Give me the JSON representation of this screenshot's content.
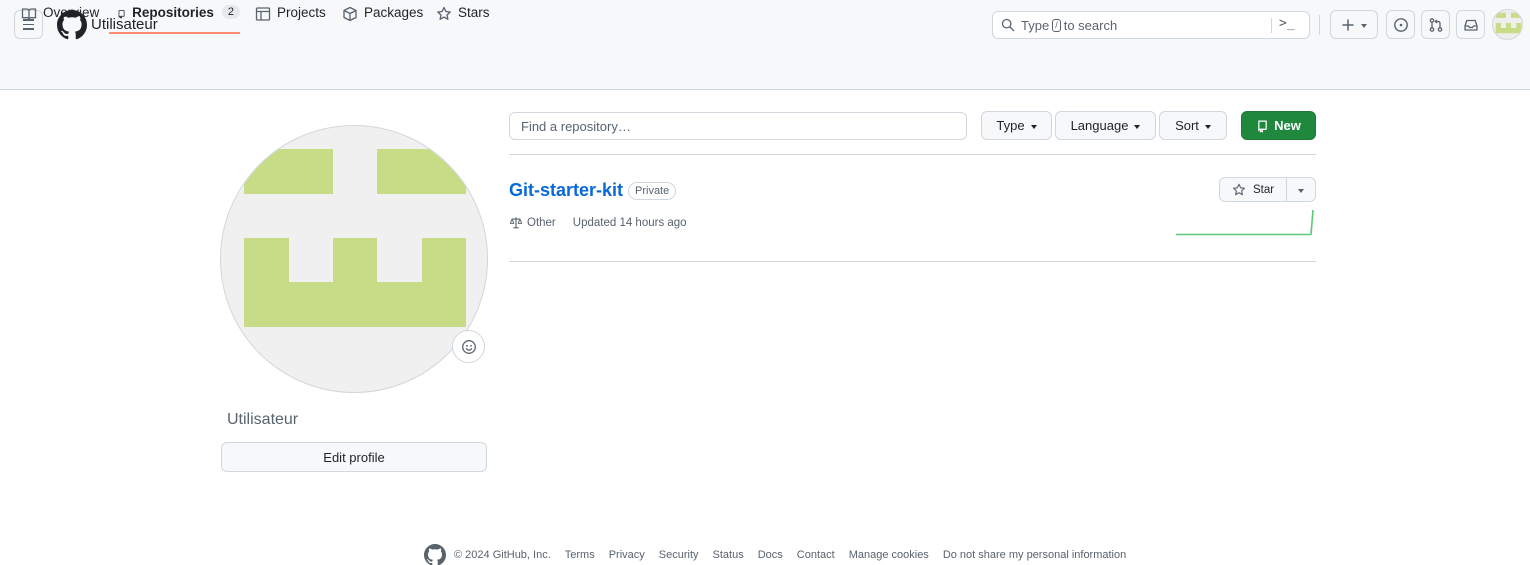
{
  "header": {
    "owner": "Utilisateur",
    "search": {
      "prefix": "Type",
      "key": "/",
      "suffix": "to search",
      "command_glyph": ">_"
    },
    "actions": [
      {
        "name": "create-new",
        "icon": "plus-icon"
      },
      {
        "name": "issues",
        "icon": "issue-opened-icon"
      },
      {
        "name": "pull-requests",
        "icon": "git-pull-request-icon"
      },
      {
        "name": "inbox",
        "icon": "inbox-icon"
      }
    ]
  },
  "tabs": [
    {
      "label": "Overview",
      "icon": "book-icon"
    },
    {
      "label": "Repositories",
      "icon": "repo-icon",
      "count": "2",
      "active": true
    },
    {
      "label": "Projects",
      "icon": "table-icon"
    },
    {
      "label": "Packages",
      "icon": "package-icon"
    },
    {
      "label": "Stars",
      "icon": "star-icon"
    }
  ],
  "profile": {
    "username": "Utilisateur",
    "edit_label": "Edit profile",
    "avatar_color": "#c8dc88",
    "avatar_bg": "#f0f0f0"
  },
  "toolbar": {
    "find_placeholder": "Find a repository…",
    "type_label": "Type",
    "language_label": "Language",
    "sort_label": "Sort",
    "new_label": "New"
  },
  "repo": {
    "name": "Git-starter-kit",
    "visibility": "Private",
    "license": "Other",
    "updated": "Updated 14 hours ago",
    "star_label": "Star"
  },
  "footer": {
    "copyright": "© 2024 GitHub, Inc.",
    "links": [
      "Terms",
      "Privacy",
      "Security",
      "Status",
      "Docs",
      "Contact",
      "Manage cookies",
      "Do not share my personal information"
    ]
  },
  "colors": {
    "accent": "#0969da",
    "new_button": "#1f883d",
    "active_tab_underline": "#fd8c73",
    "sparkline": "#4ac26b"
  }
}
